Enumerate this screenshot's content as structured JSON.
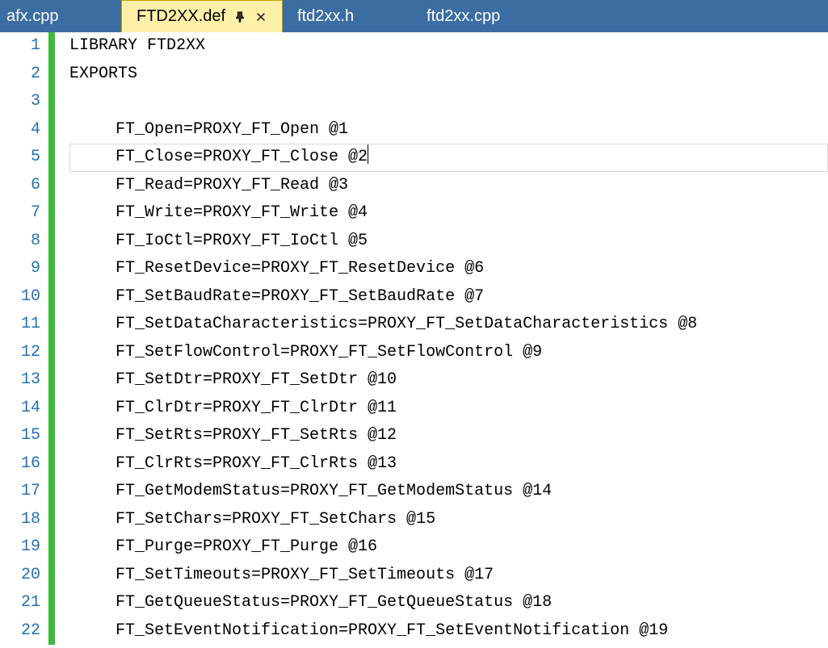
{
  "tabs": [
    {
      "label": "afx.cpp",
      "active": false,
      "pinned": false,
      "closable": false
    },
    {
      "label": "FTD2XX.def",
      "active": true,
      "pinned": true,
      "closable": true
    },
    {
      "label": "ftd2xx.h",
      "active": false,
      "pinned": false,
      "closable": false
    },
    {
      "label": "ftd2xx.cpp",
      "active": false,
      "pinned": false,
      "closable": false
    }
  ],
  "lines": [
    {
      "num": "1",
      "text": "LIBRARY FTD2XX",
      "indent": 1,
      "changed": true,
      "current": false
    },
    {
      "num": "2",
      "text": "EXPORTS",
      "indent": 1,
      "changed": true,
      "current": false
    },
    {
      "num": "3",
      "text": "",
      "indent": 1,
      "changed": true,
      "current": false
    },
    {
      "num": "4",
      "text": "FT_Open=PROXY_FT_Open @1",
      "indent": 2,
      "changed": true,
      "current": false
    },
    {
      "num": "5",
      "text": "FT_Close=PROXY_FT_Close @2",
      "indent": 2,
      "changed": true,
      "current": true
    },
    {
      "num": "6",
      "text": "FT_Read=PROXY_FT_Read @3",
      "indent": 2,
      "changed": true,
      "current": false
    },
    {
      "num": "7",
      "text": "FT_Write=PROXY_FT_Write @4",
      "indent": 2,
      "changed": true,
      "current": false
    },
    {
      "num": "8",
      "text": "FT_IoCtl=PROXY_FT_IoCtl @5",
      "indent": 2,
      "changed": true,
      "current": false
    },
    {
      "num": "9",
      "text": "FT_ResetDevice=PROXY_FT_ResetDevice @6",
      "indent": 2,
      "changed": true,
      "current": false
    },
    {
      "num": "10",
      "text": "FT_SetBaudRate=PROXY_FT_SetBaudRate @7",
      "indent": 2,
      "changed": true,
      "current": false
    },
    {
      "num": "11",
      "text": "FT_SetDataCharacteristics=PROXY_FT_SetDataCharacteristics @8",
      "indent": 2,
      "changed": true,
      "current": false
    },
    {
      "num": "12",
      "text": "FT_SetFlowControl=PROXY_FT_SetFlowControl @9",
      "indent": 2,
      "changed": true,
      "current": false
    },
    {
      "num": "13",
      "text": "FT_SetDtr=PROXY_FT_SetDtr @10",
      "indent": 2,
      "changed": true,
      "current": false
    },
    {
      "num": "14",
      "text": "FT_ClrDtr=PROXY_FT_ClrDtr @11",
      "indent": 2,
      "changed": true,
      "current": false
    },
    {
      "num": "15",
      "text": "FT_SetRts=PROXY_FT_SetRts @12",
      "indent": 2,
      "changed": true,
      "current": false
    },
    {
      "num": "16",
      "text": "FT_ClrRts=PROXY_FT_ClrRts @13",
      "indent": 2,
      "changed": true,
      "current": false
    },
    {
      "num": "17",
      "text": "FT_GetModemStatus=PROXY_FT_GetModemStatus @14",
      "indent": 2,
      "changed": true,
      "current": false
    },
    {
      "num": "18",
      "text": "FT_SetChars=PROXY_FT_SetChars @15",
      "indent": 2,
      "changed": true,
      "current": false
    },
    {
      "num": "19",
      "text": "FT_Purge=PROXY_FT_Purge @16",
      "indent": 2,
      "changed": true,
      "current": false
    },
    {
      "num": "20",
      "text": "FT_SetTimeouts=PROXY_FT_SetTimeouts @17",
      "indent": 2,
      "changed": true,
      "current": false
    },
    {
      "num": "21",
      "text": "FT_GetQueueStatus=PROXY_FT_GetQueueStatus @18",
      "indent": 2,
      "changed": true,
      "current": false
    },
    {
      "num": "22",
      "text": "FT_SetEventNotification=PROXY_FT_SetEventNotification @19",
      "indent": 2,
      "changed": true,
      "current": false
    }
  ]
}
